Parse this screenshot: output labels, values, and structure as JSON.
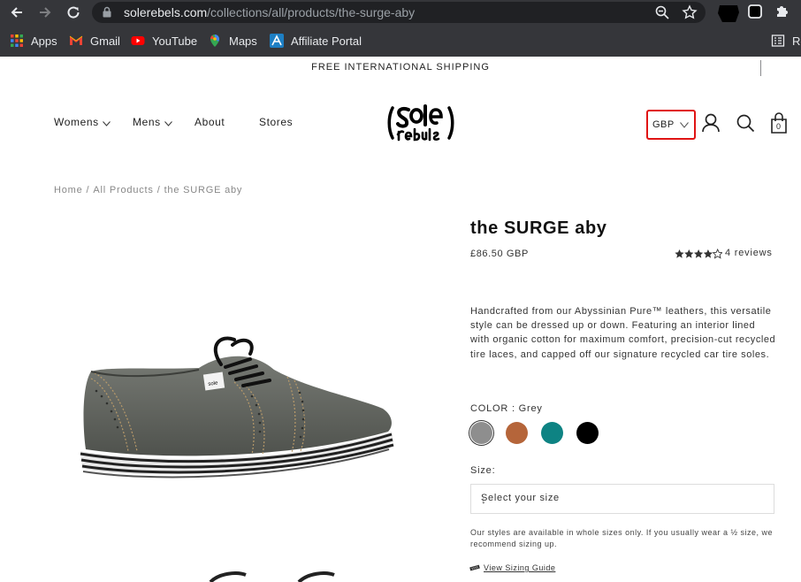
{
  "browser": {
    "url_host": "solerebels.com",
    "url_path": "/collections/all/products/the-surge-aby"
  },
  "bookmarks": [
    {
      "label": "Apps",
      "icon": "apps-grid-icon"
    },
    {
      "label": "Gmail",
      "icon": "gmail-icon"
    },
    {
      "label": "YouTube",
      "icon": "youtube-icon"
    },
    {
      "label": "Maps",
      "icon": "maps-pin-icon"
    },
    {
      "label": "Affiliate Portal",
      "icon": "affiliate-portal-icon"
    },
    {
      "label": "Re",
      "icon": "reading-list-icon"
    }
  ],
  "site": {
    "announcement": "FREE INTERNATIONAL SHIPPING",
    "nav": {
      "womens": "Womens",
      "mens": "Mens",
      "about": "About",
      "stores": "Stores"
    },
    "currency": "GBP",
    "cart_count": "0"
  },
  "breadcrumb": {
    "home": "Home",
    "sep": "/",
    "all": "All Products",
    "current": "the SURGE aby"
  },
  "product": {
    "title": "the SURGE aby",
    "price": "£86.50 GBP",
    "rating": 4.5,
    "reviews": "4 reviews",
    "description": "Handcrafted from our Abyssinian Pure™ leathers, this versatile style can be dressed up or down. Featuring an interior lined with organic cotton for maximum comfort, precision-cut recycled tire laces, and capped off our signature recycled car tire soles.",
    "color_label": "COLOR : Grey",
    "colors": [
      "#8e8e8e",
      "#b5653a",
      "#0e8383",
      "#000000"
    ],
    "selected_color": 0,
    "size_label": "Size:",
    "size_placeholder": "Select your size",
    "size_arrow": "↓",
    "size_note": "Our styles are available in whole sizes only. If you usually wear a ½ size, we recommend sizing up.",
    "sizing_guide": "View Sizing Guide"
  },
  "colors": {
    "chrome_bg": "#35363a",
    "omnibox_bg": "#202124",
    "highlight": "#e01414"
  }
}
